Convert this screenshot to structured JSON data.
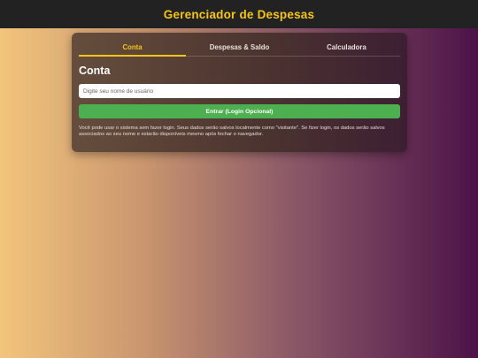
{
  "header": {
    "title": "Gerenciador de Despesas"
  },
  "tabs": [
    {
      "label": "Conta",
      "active": true
    },
    {
      "label": "Despesas & Saldo",
      "active": false
    },
    {
      "label": "Calculadora",
      "active": false
    }
  ],
  "account": {
    "title": "Conta",
    "username_placeholder": "Digite seu nome de usuário",
    "username_value": "",
    "login_label": "Entrar (Login Opcional)",
    "info": "Você pode usar o sistema sem fazer login. Seus dados serão salvos localmente como \"visitante\". Se fizer login, os dados serão salvos associados ao seu nome e estarão disponíveis mesmo após fechar o navegador."
  },
  "colors": {
    "accent": "#f5c518",
    "button": "#4caf50",
    "topbar": "#222222"
  }
}
